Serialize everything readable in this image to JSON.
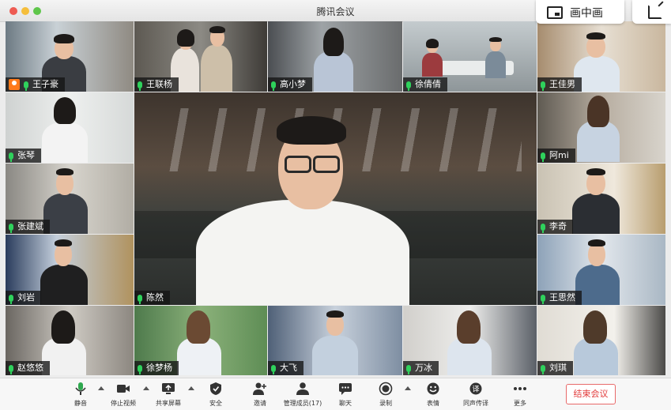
{
  "window": {
    "title": "腾讯会议"
  },
  "overlay": {
    "pip_label": "画中画"
  },
  "participants": [
    {
      "name": "王子豪"
    },
    {
      "name": "王联杨"
    },
    {
      "name": "高小梦"
    },
    {
      "name": "徐倩倩"
    },
    {
      "name": "王佳男"
    },
    {
      "name": "张琴"
    },
    {
      "name": "阿mi"
    },
    {
      "name": "张建斌"
    },
    {
      "name": "李奇"
    },
    {
      "name": "刘岩"
    },
    {
      "name": "陈然"
    },
    {
      "name": "王思然"
    },
    {
      "name": "赵悠悠"
    },
    {
      "name": "徐梦杨"
    },
    {
      "name": "大飞"
    },
    {
      "name": "万冰"
    },
    {
      "name": "刘琪"
    }
  ],
  "toolbar": {
    "mute": "静音",
    "stop_video": "停止视频",
    "share_screen": "共享屏幕",
    "security": "安全",
    "invite": "邀请",
    "manage_members": "管理成员(17)",
    "chat": "聊天",
    "record": "录制",
    "reactions": "表情",
    "translate": "同声传译",
    "more": "更多",
    "end_meeting": "结束会议"
  },
  "colors": {
    "mic": "#2fd15c",
    "host_badge": "#ff7a1a",
    "end_meeting": "#e23b3b"
  }
}
